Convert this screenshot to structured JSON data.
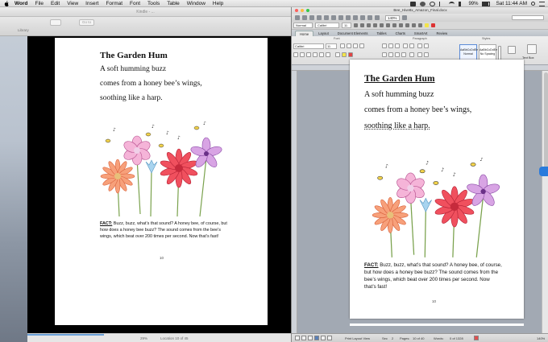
{
  "menubar": {
    "app": "Word",
    "items": [
      "File",
      "Edit",
      "View",
      "Insert",
      "Format",
      "Font",
      "Tools",
      "Table",
      "Window",
      "Help"
    ],
    "battery": "99%",
    "clock": "Sat 11:44 AM"
  },
  "kindle": {
    "window_title": "Kindle - ...",
    "library_label": "Library",
    "goto_label": "Go to",
    "percent": "29%",
    "location": "Location 10 of 45",
    "progress": 0.29
  },
  "poem": {
    "title": "The Garden Hum",
    "lines": [
      "A soft humming buzz",
      "comes from a honey bee’s wings,",
      "soothing like a harp."
    ],
    "fact_label": "FACT:",
    "fact_text": "Buzz, buzz, what’s that sound?  A honey bee, of course, but how does a honey bee buzz?  The sound comes from the bee’s wings, which beat over 200 times per second.  Now that’s fast!",
    "page_number": "10"
  },
  "word": {
    "window_title": "Bee_Hive8x_Amazon_Final.docx",
    "zoom": "140%",
    "style_value": "Normal",
    "font_value": "Calibri",
    "size_value": "11",
    "tabs": [
      "Home",
      "Layout",
      "Document Elements",
      "Tables",
      "Charts",
      "SmartArt",
      "Review"
    ],
    "ribbon_groups": [
      "Font",
      "Paragraph",
      "Styles"
    ],
    "styles": [
      "AaBbCcDdEe",
      "AaBbCcDdEe"
    ],
    "style_names": [
      "Normal",
      "No Spacing"
    ],
    "text_box_label": "Text Box",
    "status": {
      "view": "Print Layout View",
      "sec": "Sec",
      "sec_val": "2",
      "pages": "Pages:",
      "pages_val": "10 of 40",
      "words": "Words:",
      "words_val": "0 of 1328",
      "zoom": "140%"
    }
  },
  "colors": {
    "accent": "#5a7fb8",
    "dropbox": "#2a7bdc"
  }
}
